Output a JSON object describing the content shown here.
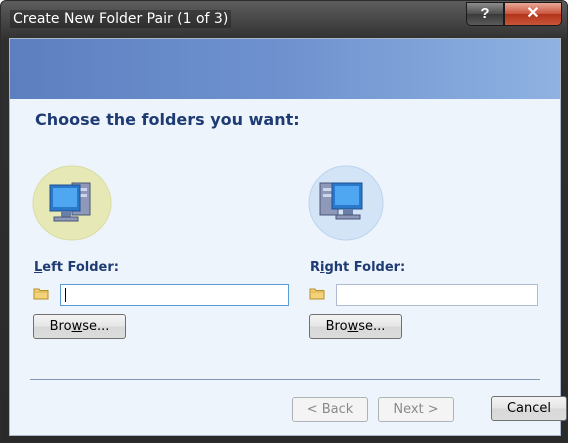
{
  "window": {
    "title": "Create New Folder Pair (1 of 3)",
    "help_glyph": "?",
    "close_glyph": "✕"
  },
  "heading": "Choose the folders you want:",
  "left": {
    "label_accel": "L",
    "label_rest": "eft Folder:",
    "path_value": "",
    "browse_accel": "w",
    "browse_pre": "Bro",
    "browse_post": "se..."
  },
  "right": {
    "label_pre": "R",
    "label_accel": "i",
    "label_rest": "ght Folder:",
    "path_value": "",
    "browse_pre": "Bro",
    "browse_accel": "w",
    "browse_post": "se..."
  },
  "buttons": {
    "back": "< Back",
    "next": "Next >",
    "cancel": "Cancel"
  },
  "colors": {
    "heading": "#1f3b73",
    "banner_start": "#5d7fc0",
    "banner_end": "#8fb2e2",
    "client_bg": "#eef4fb"
  }
}
